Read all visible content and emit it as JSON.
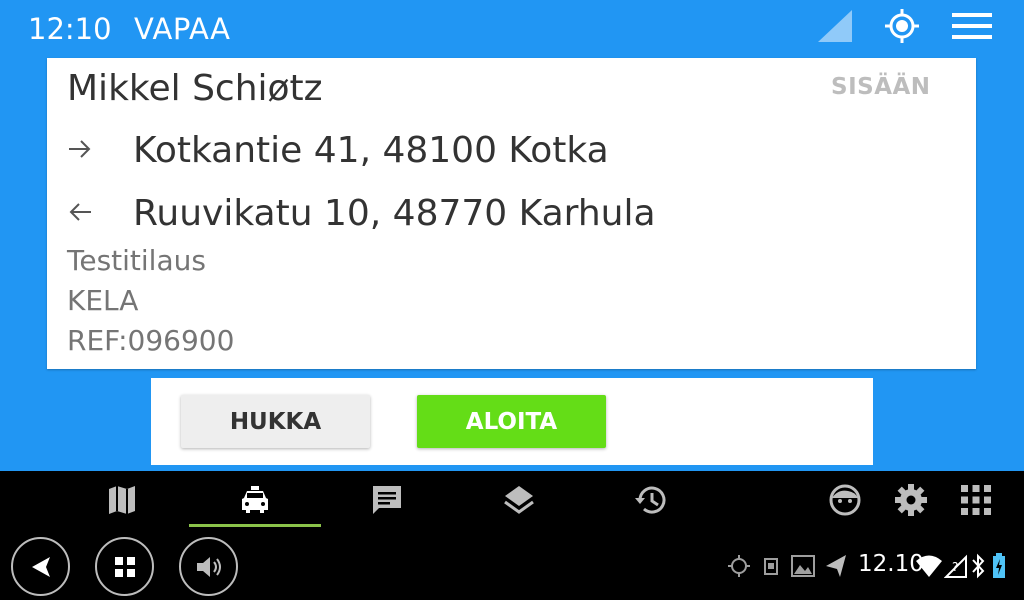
{
  "status_bar": {
    "time": "12:10",
    "status": "VAPAA"
  },
  "order": {
    "customer_name": "Mikkel Schiøtz",
    "sisaan_label": "SISÄÄN",
    "pickup_address": "Kotkantie 41, 48100 Kotka",
    "destination_address": "Ruuvikatu 10, 48770 Karhula",
    "note": "Testitilaus",
    "payer": "KELA",
    "reference": "REF:096900"
  },
  "actions": {
    "hukka_label": "HUKKA",
    "aloita_label": "ALOITA"
  },
  "nav_tabs": [
    {
      "icon": "map-icon",
      "active": false
    },
    {
      "icon": "taxi-icon",
      "active": true
    },
    {
      "icon": "message-icon",
      "active": false
    },
    {
      "icon": "layers-icon",
      "active": false
    },
    {
      "icon": "history-icon",
      "active": false
    },
    {
      "icon": "driver-face-icon",
      "active": false
    },
    {
      "icon": "settings-gear-icon",
      "active": false
    },
    {
      "icon": "apps-grid-icon",
      "active": false
    }
  ],
  "system_tray": {
    "clock": "12.10"
  },
  "colors": {
    "primary_blue": "#2196F3",
    "accept_green": "#64DD17",
    "active_tab_underline": "#8BC34A"
  }
}
